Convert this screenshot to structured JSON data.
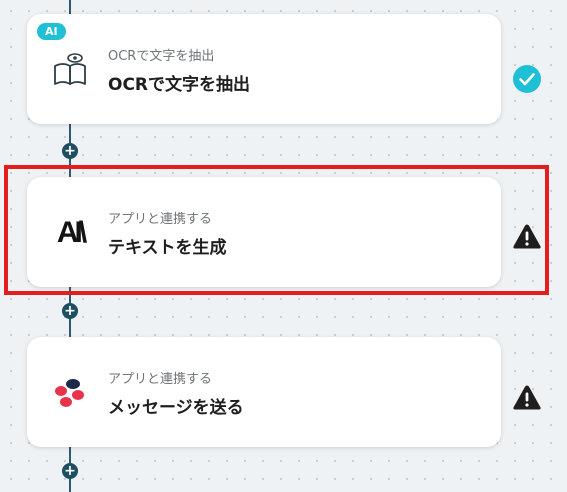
{
  "flow": {
    "steps": [
      {
        "badge": "AI",
        "subtitle": "OCRで文字を抽出",
        "title": "OCRで文字を抽出",
        "icon": "open-book-eye-icon",
        "status": "complete"
      },
      {
        "subtitle": "アプリと連携する",
        "title": "テキストを生成",
        "icon": "anthropic-logo-icon",
        "logo_text": "AI\\",
        "status": "warning"
      },
      {
        "subtitle": "アプリと連携する",
        "title": "メッセージを送る",
        "icon": "chatwork-logo-icon",
        "status": "warning"
      }
    ],
    "add_button_label": "+"
  },
  "colors": {
    "background": "#eef2f4",
    "connector": "#2c5a6e",
    "add_node": "#1f4f62",
    "ai_badge": "#1fbfd6",
    "success": "#1fbfd6",
    "warning": "#1e1e1e",
    "highlight": "#e41e1e",
    "chatwork_red": "#e8334a",
    "chatwork_navy": "#1e2a4a"
  }
}
